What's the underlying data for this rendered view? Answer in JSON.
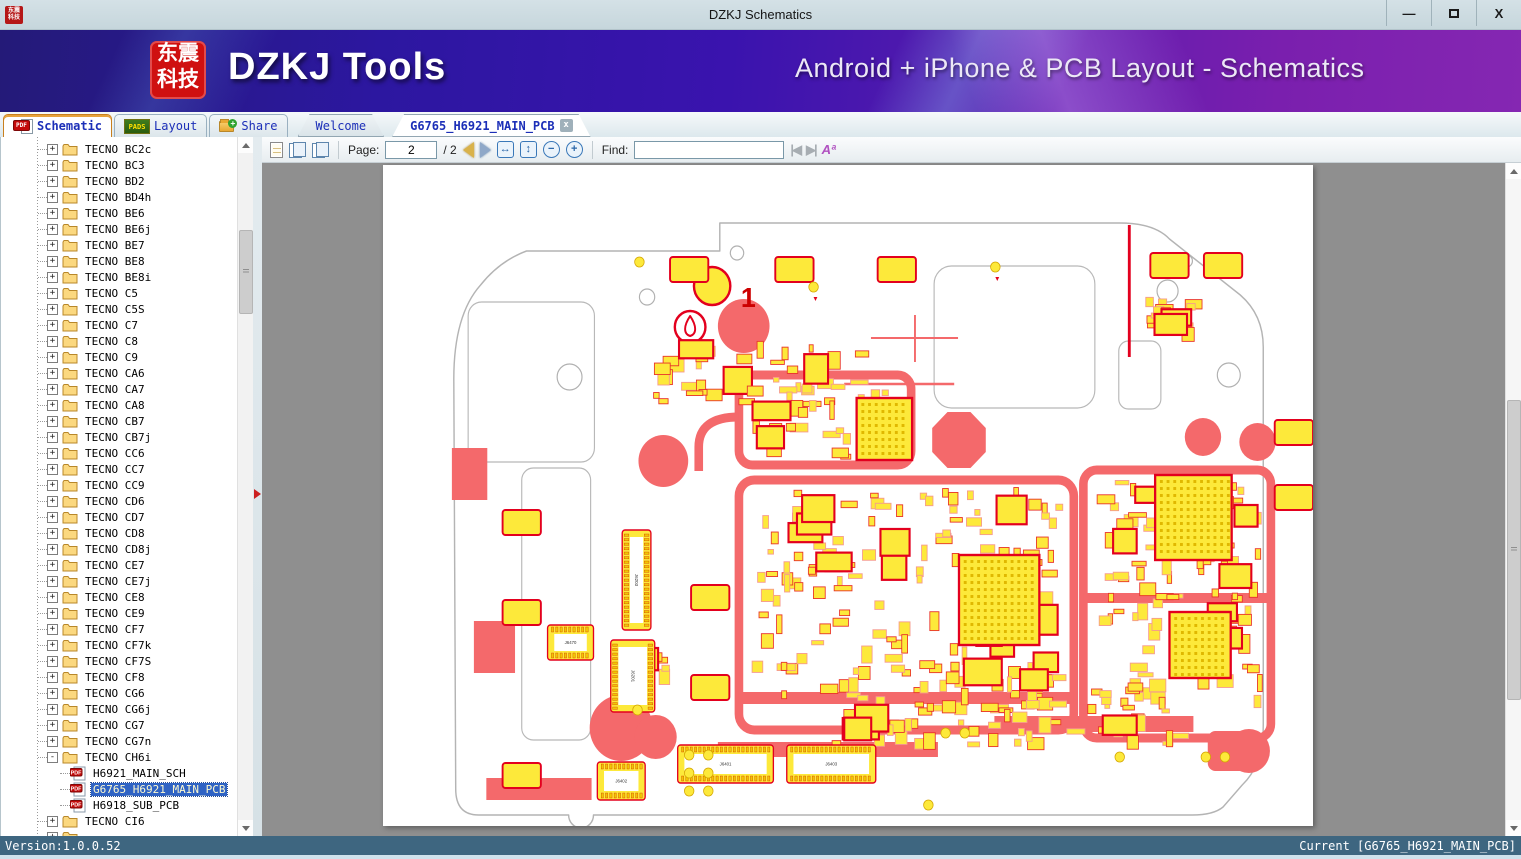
{
  "window": {
    "title": "DZKJ Schematics",
    "minimize": "—",
    "close": "X"
  },
  "banner": {
    "logo_line1": "东震",
    "logo_line2": "科技",
    "product": "DZKJ Tools",
    "slogan": "Android + iPhone & PCB Layout - Schematics"
  },
  "icons": {
    "pdf_badge": "PDF",
    "pads_badge": "PADS",
    "share_plus": "+",
    "tab_close": "x",
    "match_case": "Aª"
  },
  "tabs": [
    {
      "label": "Schematic"
    },
    {
      "label": "Layout"
    },
    {
      "label": "Share"
    }
  ],
  "doc_tabs": [
    {
      "label": "Welcome"
    },
    {
      "label": "G6765_H6921_MAIN_PCB"
    }
  ],
  "toolbar": {
    "page_label": "Page:",
    "page_value": "2",
    "page_total": "/ 2",
    "find_label": "Find:",
    "find_value": ""
  },
  "tree": {
    "items": [
      {
        "label": "TECNO BC2c"
      },
      {
        "label": "TECNO BC3"
      },
      {
        "label": "TECNO BD2"
      },
      {
        "label": "TECNO BD4h"
      },
      {
        "label": "TECNO BE6"
      },
      {
        "label": "TECNO BE6j"
      },
      {
        "label": "TECNO BE7"
      },
      {
        "label": "TECNO BE8"
      },
      {
        "label": "TECNO BE8i"
      },
      {
        "label": "TECNO C5"
      },
      {
        "label": "TECNO C5S"
      },
      {
        "label": "TECNO C7"
      },
      {
        "label": "TECNO C8"
      },
      {
        "label": "TECNO C9"
      },
      {
        "label": "TECNO CA6"
      },
      {
        "label": "TECNO CA7"
      },
      {
        "label": "TECNO CA8"
      },
      {
        "label": "TECNO CB7"
      },
      {
        "label": "TECNO CB7j"
      },
      {
        "label": "TECNO CC6"
      },
      {
        "label": "TECNO CC7"
      },
      {
        "label": "TECNO CC9"
      },
      {
        "label": "TECNO CD6"
      },
      {
        "label": "TECNO CD7"
      },
      {
        "label": "TECNO CD8"
      },
      {
        "label": "TECNO CD8j"
      },
      {
        "label": "TECNO CE7"
      },
      {
        "label": "TECNO CE7j"
      },
      {
        "label": "TECNO CE8"
      },
      {
        "label": "TECNO CE9"
      },
      {
        "label": "TECNO CF7"
      },
      {
        "label": "TECNO CF7k"
      },
      {
        "label": "TECNO CF7S"
      },
      {
        "label": "TECNO CF8"
      },
      {
        "label": "TECNO CG6"
      },
      {
        "label": "TECNO CG6j"
      },
      {
        "label": "TECNO CG7"
      },
      {
        "label": "TECNO CG7n"
      },
      {
        "label": "TECNO CH6i",
        "expanded": true,
        "children": [
          {
            "label": "H6921_MAIN_SCH"
          },
          {
            "label": "G6765_H6921_MAIN_PCB",
            "selected": true
          },
          {
            "label": "H6918_SUB_PCB"
          }
        ]
      },
      {
        "label": "TECNO CI6"
      },
      {
        "label": "",
        "partial": true
      }
    ]
  },
  "pcb": {
    "marker": "1",
    "connector_labels": [
      "J6402",
      "J6401",
      "J6403",
      "J6470",
      "J6203",
      "J6201"
    ]
  },
  "statusbar": {
    "version": "Version:1.0.0.52",
    "current": "Current [G6765_H6921_MAIN_PCB]"
  }
}
